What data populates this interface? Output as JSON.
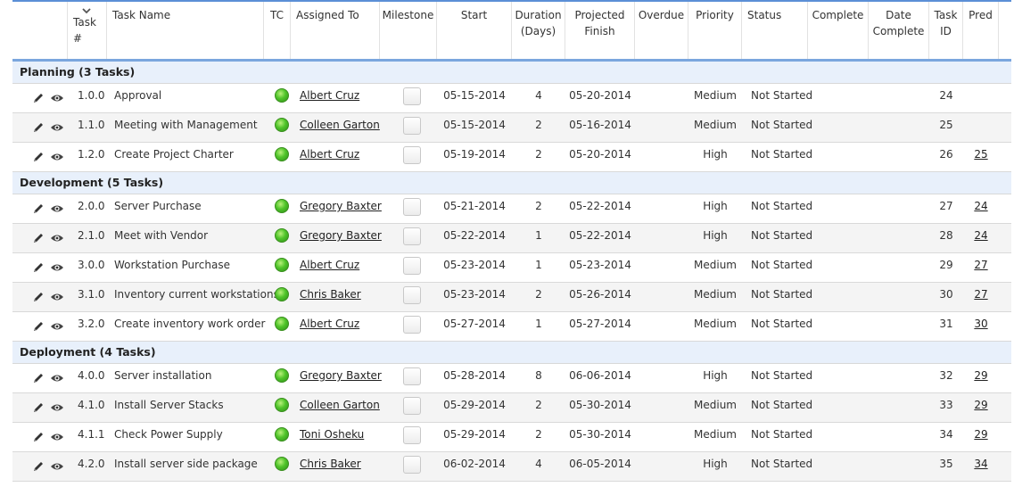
{
  "columns": [
    {
      "key": "task_num",
      "label": "Task\n#"
    },
    {
      "key": "task_name",
      "label": "Task Name"
    },
    {
      "key": "tc",
      "label": "TC"
    },
    {
      "key": "assigned",
      "label": "Assigned To"
    },
    {
      "key": "milestone",
      "label": "Milestone"
    },
    {
      "key": "start",
      "label": "Start"
    },
    {
      "key": "duration",
      "label": "Duration\n(Days)"
    },
    {
      "key": "finish",
      "label": "Projected\nFinish"
    },
    {
      "key": "overdue",
      "label": "Overdue"
    },
    {
      "key": "priority",
      "label": "Priority"
    },
    {
      "key": "status",
      "label": "Status"
    },
    {
      "key": "complete",
      "label": "Complete"
    },
    {
      "key": "date_complete",
      "label": "Date\nComplete"
    },
    {
      "key": "task_id",
      "label": "Task\nID"
    },
    {
      "key": "pred",
      "label": "Pred"
    }
  ],
  "groups": [
    {
      "label": "Planning  (3 Tasks)",
      "rows": [
        {
          "num": "1.0.0",
          "name": "Approval",
          "assigned": "Albert Cruz",
          "start": "05-15-2014",
          "duration": "4",
          "finish": "05-20-2014",
          "priority": "Medium",
          "status": "Not Started",
          "id": "24",
          "pred": ""
        },
        {
          "num": "1.1.0",
          "name": "Meeting with Management",
          "assigned": "Colleen Garton",
          "start": "05-15-2014",
          "duration": "2",
          "finish": "05-16-2014",
          "priority": "Medium",
          "status": "Not Started",
          "id": "25",
          "pred": ""
        },
        {
          "num": "1.2.0",
          "name": "Create Project Charter",
          "assigned": "Albert Cruz",
          "start": "05-19-2014",
          "duration": "2",
          "finish": "05-20-2014",
          "priority": "High",
          "status": "Not Started",
          "id": "26",
          "pred": "25"
        }
      ]
    },
    {
      "label": "Development  (5 Tasks)",
      "rows": [
        {
          "num": "2.0.0",
          "name": "Server Purchase",
          "assigned": "Gregory Baxter",
          "start": "05-21-2014",
          "duration": "2",
          "finish": "05-22-2014",
          "priority": "High",
          "status": "Not Started",
          "id": "27",
          "pred": "24"
        },
        {
          "num": "2.1.0",
          "name": "Meet with Vendor",
          "assigned": "Gregory Baxter",
          "start": "05-22-2014",
          "duration": "1",
          "finish": "05-22-2014",
          "priority": "High",
          "status": "Not Started",
          "id": "28",
          "pred": "24"
        },
        {
          "num": "3.0.0",
          "name": "Workstation Purchase",
          "assigned": "Albert Cruz",
          "start": "05-23-2014",
          "duration": "1",
          "finish": "05-23-2014",
          "priority": "Medium",
          "status": "Not Started",
          "id": "29",
          "pred": "27"
        },
        {
          "num": "3.1.0",
          "name": "Inventory current workstations",
          "assigned": "Chris Baker",
          "start": "05-23-2014",
          "duration": "2",
          "finish": "05-26-2014",
          "priority": "Medium",
          "status": "Not Started",
          "id": "30",
          "pred": "27"
        },
        {
          "num": "3.2.0",
          "name": "Create inventory work order",
          "assigned": "Albert Cruz",
          "start": "05-27-2014",
          "duration": "1",
          "finish": "05-27-2014",
          "priority": "Medium",
          "status": "Not Started",
          "id": "31",
          "pred": "30"
        }
      ]
    },
    {
      "label": "Deployment  (4 Tasks)",
      "rows": [
        {
          "num": "4.0.0",
          "name": "Server installation",
          "assigned": "Gregory Baxter",
          "start": "05-28-2014",
          "duration": "8",
          "finish": "06-06-2014",
          "priority": "High",
          "status": "Not Started",
          "id": "32",
          "pred": "29"
        },
        {
          "num": "4.1.0",
          "name": "Install Server Stacks",
          "assigned": "Colleen Garton",
          "start": "05-29-2014",
          "duration": "2",
          "finish": "05-30-2014",
          "priority": "Medium",
          "status": "Not Started",
          "id": "33",
          "pred": "29"
        },
        {
          "num": "4.1.1",
          "name": "Check Power Supply",
          "assigned": "Toni Osheku",
          "start": "05-29-2014",
          "duration": "2",
          "finish": "05-30-2014",
          "priority": "Medium",
          "status": "Not Started",
          "id": "34",
          "pred": "29"
        },
        {
          "num": "4.2.0",
          "name": "Install server side package",
          "assigned": "Chris Baker",
          "start": "06-02-2014",
          "duration": "4",
          "finish": "06-05-2014",
          "priority": "High",
          "status": "Not Started",
          "id": "35",
          "pred": "34"
        }
      ]
    }
  ],
  "icons": {
    "edit": "pencil-icon",
    "view": "eye-icon",
    "tc": "green-status-dot",
    "sort": "chevron-down-icon"
  },
  "colors": {
    "accent": "#5b8fd6",
    "group_bg": "#e8f0fb",
    "tc_green": "#4fc42a"
  }
}
